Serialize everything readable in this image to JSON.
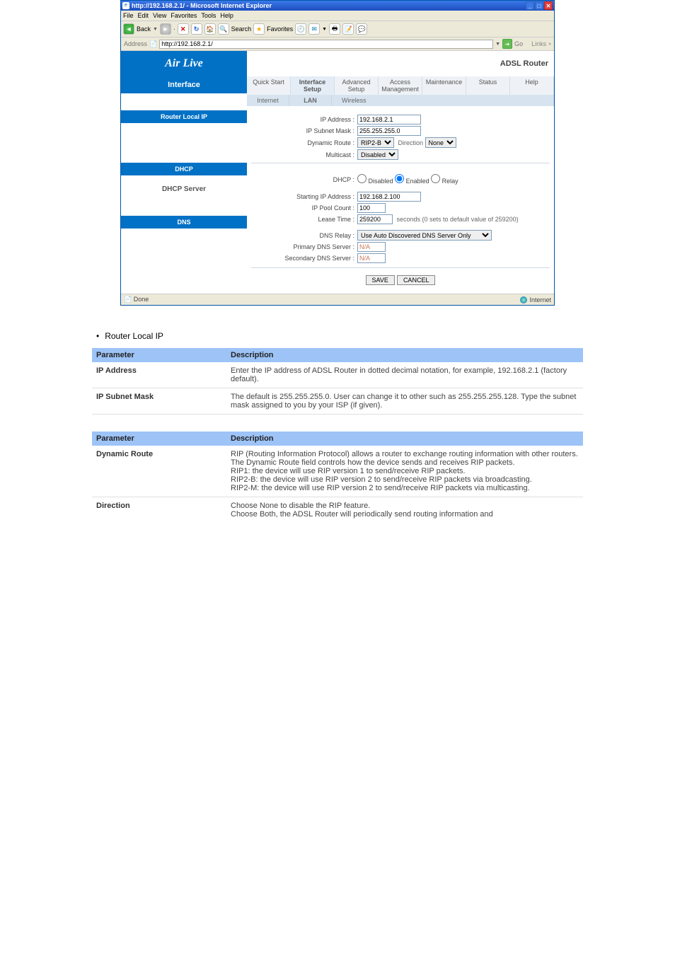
{
  "window": {
    "title": "http://192.168.2.1/ - Microsoft Internet Explorer",
    "menubar": [
      "File",
      "Edit",
      "View",
      "Favorites",
      "Tools",
      "Help"
    ],
    "toolbar": {
      "back": "Back",
      "search": "Search",
      "favorites": "Favorites"
    },
    "address_label": "Address",
    "address_value": "http://192.168.2.1/",
    "go": "Go",
    "links": "Links",
    "status_left": "Done",
    "status_right": "Internet"
  },
  "brand": {
    "logo": "Air Live",
    "product": "ADSL Router"
  },
  "tabs": {
    "items": [
      {
        "label": "Quick Start"
      },
      {
        "label": "Interface Setup"
      },
      {
        "label": "Advanced Setup"
      },
      {
        "label": "Access Management"
      },
      {
        "label": "Maintenance"
      },
      {
        "label": "Status"
      },
      {
        "label": "Help"
      }
    ],
    "sub": [
      {
        "label": "Internet"
      },
      {
        "label": "LAN"
      },
      {
        "label": "Wireless"
      }
    ]
  },
  "left": {
    "heading": "Interface",
    "router_local_ip": "Router Local IP",
    "dhcp": "DHCP",
    "dhcp_server_label": "DHCP Server",
    "dns": "DNS"
  },
  "form": {
    "ip_address_label": "IP Address :",
    "ip_address_value": "192.168.2.1",
    "subnet_label": "IP Subnet Mask :",
    "subnet_value": "255.255.255.0",
    "dynroute_label": "Dynamic Route :",
    "dynroute_value": "RIP2-B",
    "direction_label": "Direction",
    "direction_value": "None",
    "multicast_label": "Multicast :",
    "multicast_value": "Disabled",
    "dhcp_label": "DHCP :",
    "dhcp_opt_disabled": "Disabled",
    "dhcp_opt_enabled": "Enabled",
    "dhcp_opt_relay": "Relay",
    "start_ip_label": "Starting IP Address :",
    "start_ip_value": "192.168.2.100",
    "pool_label": "IP Pool Count :",
    "pool_value": "100",
    "lease_label": "Lease Time :",
    "lease_value": "259200",
    "lease_hint": "seconds  (0 sets to default value of 259200)",
    "dnsrelay_label": "DNS Relay :",
    "dnsrelay_value": "Use Auto Discovered DNS Server Only",
    "pdns_label": "Primary DNS Server :",
    "pdns_value": "N/A",
    "sdns_label": "Secondary DNS Server :",
    "sdns_value": "N/A",
    "save": "SAVE",
    "cancel": "CANCEL"
  },
  "doc": {
    "bullet": "Router Local IP",
    "table1": {
      "h1": "Parameter",
      "h2": "Description",
      "rows": [
        {
          "p": "IP Address",
          "d": "Enter the IP address of ADSL Router in dotted decimal notation, for example, 192.168.2.1 (factory default)."
        },
        {
          "p": "IP Subnet Mask",
          "d": "The default is 255.255.255.0. User can change it to other such as 255.255.255.128. Type the subnet mask assigned to you by your ISP (if given)."
        }
      ]
    },
    "table2": {
      "h1": "Parameter",
      "h2": "Description",
      "rows": [
        {
          "p": "Dynamic Route",
          "d": "RIP (Routing Information Protocol) allows a router to exchange routing information with other routers. The Dynamic Route field controls how the device sends and receives RIP packets.\nRIP1: the device will use RIP version 1 to send/receive RIP packets.\nRIP2-B: the device will use RIP version 2 to send/receive RIP packets via broadcasting.\nRIP2-M: the device will use RIP version 2 to send/receive RIP packets via multicasting."
        },
        {
          "p": "Direction",
          "d": "Choose None to disable the RIP feature.\nChoose Both, the ADSL Router will periodically send routing information and"
        }
      ]
    }
  }
}
